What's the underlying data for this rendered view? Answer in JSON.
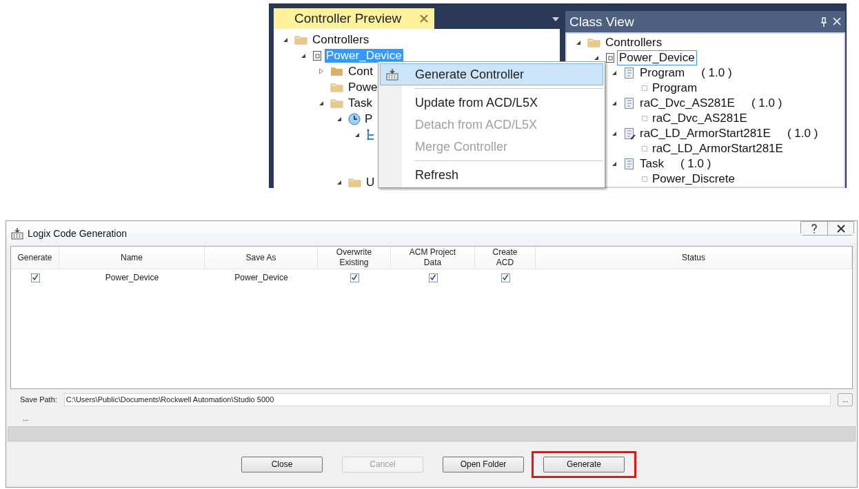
{
  "controller_preview": {
    "title": "Controller Preview",
    "active": true,
    "tree": [
      {
        "label": "Controllers",
        "kind": "folder",
        "expanded": true,
        "selected": false,
        "children": [
          {
            "label": "Power_Device",
            "kind": "device",
            "expanded": true,
            "selected": true,
            "children": [
              {
                "label": "Cont",
                "kind": "folder-closed",
                "expanded": false,
                "selected": false
              },
              {
                "label": "Powe",
                "kind": "folder",
                "selected": false
              },
              {
                "label": "Task",
                "kind": "folder",
                "expanded": true,
                "selected": false,
                "children": [
                  {
                    "label": "P",
                    "kind": "clock",
                    "expanded": true,
                    "selected": false,
                    "children": [
                      {
                        "kind": "program",
                        "expanded": true,
                        "selected": false
                      }
                    ]
                  },
                  {
                    "label": "U",
                    "kind": "folder",
                    "expanded": true,
                    "selected": false
                  }
                ]
              }
            ]
          }
        ]
      }
    ]
  },
  "context_menu": [
    {
      "kind": "item",
      "label": "Generate Controller",
      "icon": true,
      "highlighted": true,
      "disabled": false
    },
    {
      "kind": "separator"
    },
    {
      "kind": "item",
      "label": "Update from ACD/L5X",
      "icon": false,
      "highlighted": false,
      "disabled": false
    },
    {
      "kind": "item",
      "label": "Detach from ACD/L5X",
      "icon": false,
      "highlighted": false,
      "disabled": true
    },
    {
      "kind": "item",
      "label": "Merge Controller",
      "icon": false,
      "highlighted": false,
      "disabled": true
    },
    {
      "kind": "separator"
    },
    {
      "kind": "item",
      "label": "Refresh",
      "icon": false,
      "highlighted": false,
      "disabled": false
    }
  ],
  "class_view": {
    "title": "Class View",
    "tree": [
      {
        "label": "Controllers",
        "kind": "folder",
        "expanded": true,
        "selected": false,
        "children": [
          {
            "label": "Power_Device",
            "kind": "device",
            "expanded": true,
            "selected": true,
            "children": [
              {
                "label": "Program",
                "version": "( 1.0 )",
                "kind": "class",
                "expanded": true,
                "selected": false,
                "children": [
                  {
                    "label": "Program",
                    "kind": "member",
                    "selected": false
                  }
                ]
              },
              {
                "label": "raC_Dvc_AS281E",
                "version": "( 1.0 )",
                "kind": "class",
                "expanded": true,
                "selected": false,
                "children": [
                  {
                    "label": "raC_Dvc_AS281E",
                    "kind": "member",
                    "selected": false
                  }
                ]
              },
              {
                "label": "raC_LD_ArmorStart281E",
                "version": "( 1.0 )",
                "kind": "class-edit",
                "expanded": true,
                "selected": false,
                "children": [
                  {
                    "label": "raC_LD_ArmorStart281E",
                    "kind": "member",
                    "selected": false
                  }
                ]
              },
              {
                "label": "Task",
                "version": "( 1.0 )",
                "kind": "class",
                "expanded": true,
                "selected": false,
                "children": [
                  {
                    "label": "Power_Discrete",
                    "kind": "member",
                    "selected": false
                  }
                ]
              }
            ]
          }
        ]
      }
    ]
  },
  "dialog": {
    "title": "Logix Code Generation",
    "columns": [
      "Generate",
      "Name",
      "Save As",
      "Overwrite Existing",
      "ACM Project Data",
      "Create ACD",
      "Status"
    ],
    "rows": [
      {
        "generate": true,
        "name": "Power_Device",
        "save_as": "Power_Device",
        "overwrite_existing": true,
        "acm_project_data": true,
        "create_acd": true
      }
    ],
    "save_path_label": "Save Path:",
    "save_path": "C:\\Users\\Public\\Documents\\Rockwell Automation\\Studio 5000",
    "browse": "...",
    "status_text": "...",
    "progress": {
      "level": 0
    },
    "buttons": [
      {
        "label": "Close",
        "disabled": false,
        "highlighted": false
      },
      {
        "label": "Cancel",
        "disabled": true,
        "highlighted": false
      },
      {
        "label": "Open Folder",
        "disabled": false,
        "highlighted": false
      },
      {
        "label": "Generate",
        "disabled": false,
        "highlighted": true
      }
    ]
  }
}
